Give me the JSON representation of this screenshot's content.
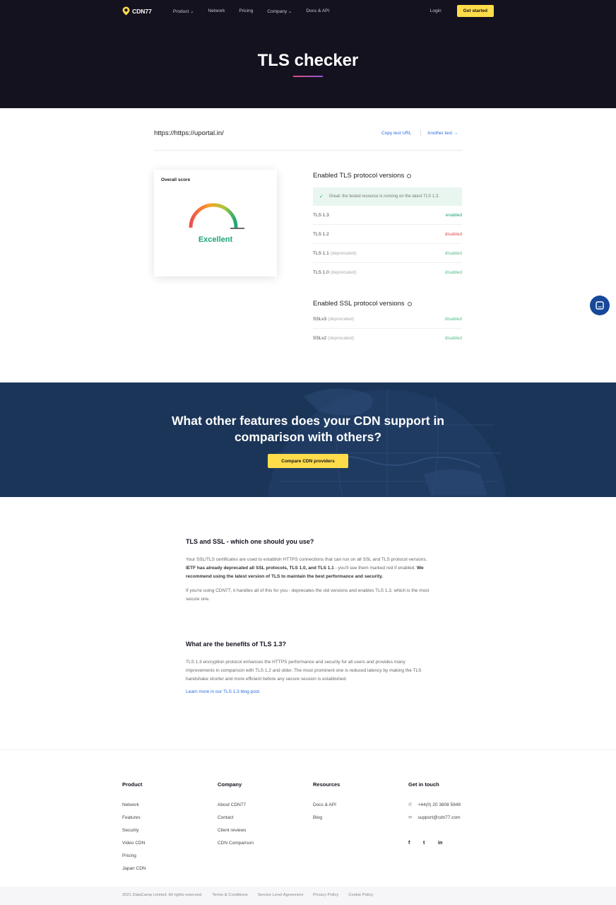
{
  "header": {
    "logo_text": "CDN77",
    "nav": [
      "Product",
      "Network",
      "Pricing",
      "Company",
      "Docs & API"
    ],
    "login": "Login",
    "get_started": "Get started",
    "title": "TLS checker"
  },
  "checker": {
    "url": "https://https://uportal.in/",
    "copy_url": "Copy test URL",
    "another_test": "Another test"
  },
  "score": {
    "label": "Overall score",
    "value": "Excellent"
  },
  "tls": {
    "title": "Enabled TLS protocol versions",
    "notice": "Great: the tested resource is running on the latest TLS 1.3.",
    "rows": [
      {
        "name": "TLS 1.3",
        "note": "",
        "status": "enabled"
      },
      {
        "name": "TLS 1.2",
        "note": "",
        "status": "disabled"
      },
      {
        "name": "TLS 1.1",
        "note": "(deprecated)",
        "status": "disabled"
      },
      {
        "name": "TLS 1.0",
        "note": "(deprecated)",
        "status": "disabled"
      }
    ]
  },
  "ssl": {
    "title": "Enabled SSL protocol versions",
    "rows": [
      {
        "name": "SSLv3",
        "note": "(deprecated)",
        "status": "disabled"
      },
      {
        "name": "SSLv2",
        "note": "(deprecated)",
        "status": "disabled"
      }
    ]
  },
  "banner": {
    "line1": "What other features does your CDN support in",
    "line2": "comparison with others?",
    "button": "Compare CDN providers"
  },
  "article": {
    "h1": "TLS and SSL - which one should you use?",
    "p1_a": "Your SSL/TLS certificates are used to establish HTTPS connections that can run on all SSL and TLS protocol versions. ",
    "p1_b": "IETF has already deprecated all SSL protocols, TLS 1.0, and TLS 1.1",
    "p1_c": " - you'll see them marked red if enabled. ",
    "p1_d": "We recommend using the latest version of TLS to maintain the best performance and security.",
    "p2": "If you're using CDN77, it handles all of this for you - deprecates the old versions and enables TLS 1.3, which is the most secure one.",
    "h2": "What are the benefits of TLS 1.3?",
    "p3": "TLS 1.3 encryption protocol enhances the HTTPS performance and security for all users and provides many improvements in comparison with TLS 1.2 and older. The most prominent one is reduced latency by making the TLS handshake shorter and more efficient before any secure session is established.",
    "link": "Learn more in our TLS 1.3 blog post."
  },
  "footer": {
    "product": {
      "title": "Product",
      "items": [
        "Network",
        "Features",
        "Security",
        "Video CDN",
        "Pricing",
        "Japan CDN"
      ]
    },
    "company": {
      "title": "Company",
      "items": [
        "About CDN77",
        "Contact",
        "Client reviews",
        "CDN Comparison"
      ]
    },
    "resources": {
      "title": "Resources",
      "items": [
        "Docs & API",
        "Blog"
      ]
    },
    "contact": {
      "title": "Get in touch",
      "phone": "+44(0) 20 3808 5949",
      "email": "support@cdn77.com"
    },
    "social": [
      "f",
      "t",
      "in"
    ],
    "bottom": [
      "2021 DataCamp Limited. All rights reserved.",
      "Terms & Conditions",
      "Service Level Agreement",
      "Privacy Policy",
      "Cookie Policy"
    ]
  }
}
